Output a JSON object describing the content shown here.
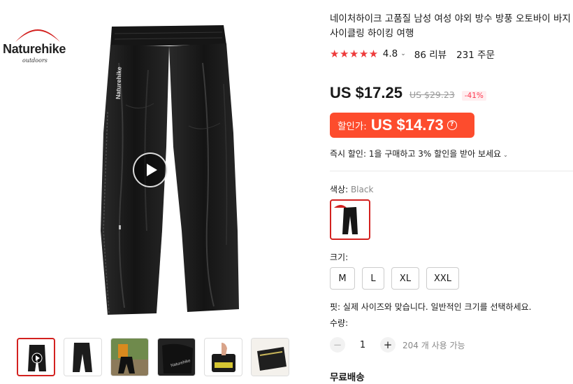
{
  "brand": {
    "name": "Naturehike",
    "tagline": "outdoors",
    "logo_color": "#d3211f"
  },
  "gallery": {
    "main_image": "black rain pants with Naturehike logo",
    "play_icon": "play-icon",
    "thumbnails": [
      {
        "name": "thumb-video",
        "active": true
      },
      {
        "name": "thumb-pants-side"
      },
      {
        "name": "thumb-model-wearing"
      },
      {
        "name": "thumb-pants-detail"
      },
      {
        "name": "thumb-pouch-hand"
      },
      {
        "name": "thumb-packed-bag"
      }
    ]
  },
  "product": {
    "title": "네이처하이크 고품질 남성 여성 야외 방수 방풍 오토바이 바지 사이클링 하이킹 여행",
    "stars": "★★★★★",
    "rating": "4.8",
    "reviews": "86 리뷰",
    "orders": "231 주문",
    "price": "US $17.25",
    "old_price": "US $29.23",
    "discount": "-41%",
    "sale_label": "할인가:",
    "sale_price": "US $14.73",
    "promo": "즉시 할인: 1을 구매하고 3% 할인을 받아 보세요",
    "color_label": "색상: ",
    "color_value": "Black",
    "size_label": "크기:",
    "sizes": [
      "M",
      "L",
      "XL",
      "XXL"
    ],
    "fit_note": "핏: 실제 사이즈와 맞습니다. 일반적인 크기를 선택하세요.",
    "qty_label": "수량:",
    "qty_value": "1",
    "qty_minus": "−",
    "qty_plus": "+",
    "stock": "204 개 사용 가능",
    "shipping": "무료배송"
  },
  "colors": {
    "accent": "#d3211f",
    "sale_bg": "#fd4c2d",
    "star": "#ee3b3b",
    "discount": "#fd384f"
  }
}
